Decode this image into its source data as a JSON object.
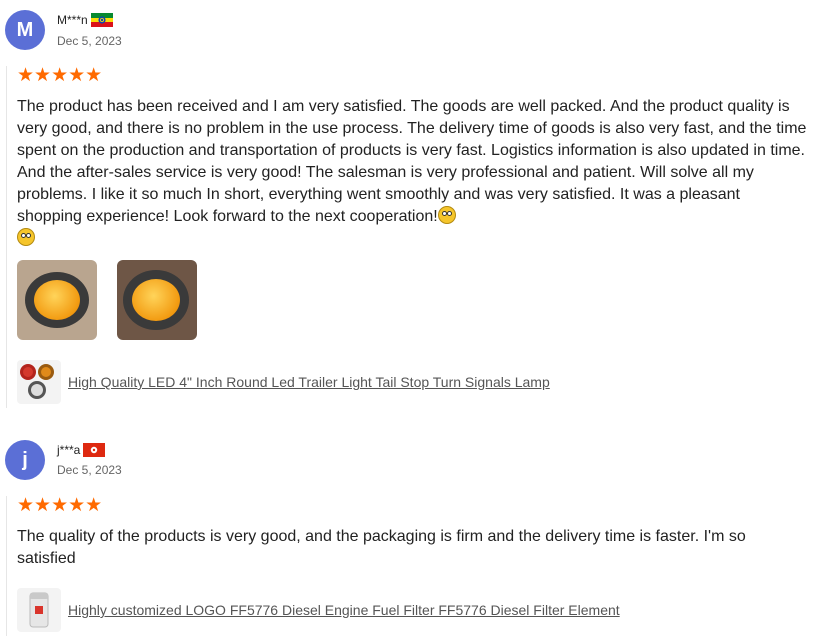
{
  "reviews": [
    {
      "avatar_letter": "M",
      "name": "M***n",
      "flag": "ethiopia-flag",
      "date": "Dec 5, 2023",
      "rating": 5,
      "stars": "★★★★★",
      "text": "The product has been received and I am very satisfied. The goods are well packed. And the product quality is very good, and there is no problem in the use process. The delivery time of goods is also very fast, and the time spent on the production and transportation of products is very fast. Logistics information is also updated in time. And the after-sales service is very good! The salesman is very professional and patient. Will solve all my problems. I like it so much In short, everything went smoothly and was very satisfied. It was a pleasant shopping experience! Look forward to the next cooperation!",
      "product_link": "High Quality LED 4\" Inch Round Led Trailer Light Tail Stop Turn Signals Lamp"
    },
    {
      "avatar_letter": "j",
      "name": "j***a",
      "flag": "hong-kong-flag",
      "date": "Dec 5, 2023",
      "rating": 5,
      "stars": "★★★★★",
      "text": "The quality of the products is very good, and the packaging is firm and the delivery time is faster. I'm so satisfied",
      "product_link": "Highly customized LOGO FF5776 Diesel Engine Fuel Filter FF5776 Diesel Filter Element"
    }
  ],
  "colors": {
    "avatar": "#5b6fd6",
    "star": "#ff6a00",
    "link": "#555555"
  }
}
